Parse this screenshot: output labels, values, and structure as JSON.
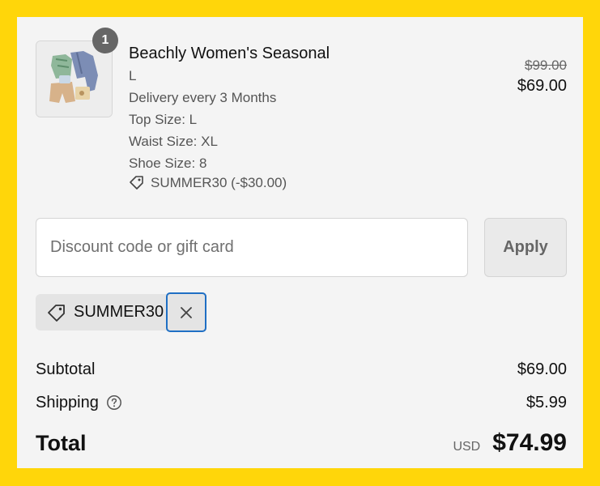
{
  "product": {
    "quantity": "1",
    "name": "Beachly Women's Seasonal",
    "variant": "L",
    "delivery": "Delivery every 3 Months",
    "top_size": "Top Size: L",
    "waist_size": "Waist Size: XL",
    "shoe_size": "Shoe Size: 8",
    "discount_applied": "SUMMER30 (-$30.00)",
    "original_price": "$99.00",
    "price": "$69.00",
    "image_icon": "clothing-bundle-image"
  },
  "discount": {
    "placeholder": "Discount code or gift card",
    "value": "",
    "apply_label": "Apply"
  },
  "applied_code": {
    "label": "SUMMER30",
    "icon": "tag-icon",
    "remove_icon": "close-icon"
  },
  "summary": {
    "subtotal_label": "Subtotal",
    "subtotal_value": "$69.00",
    "shipping_label": "Shipping",
    "shipping_value": "$5.99",
    "total_label": "Total",
    "currency": "USD",
    "total_value": "$74.99"
  },
  "colors": {
    "background": "#FFD60A",
    "panel": "#F4F4F4",
    "focus_ring": "#1F6FC4"
  }
}
